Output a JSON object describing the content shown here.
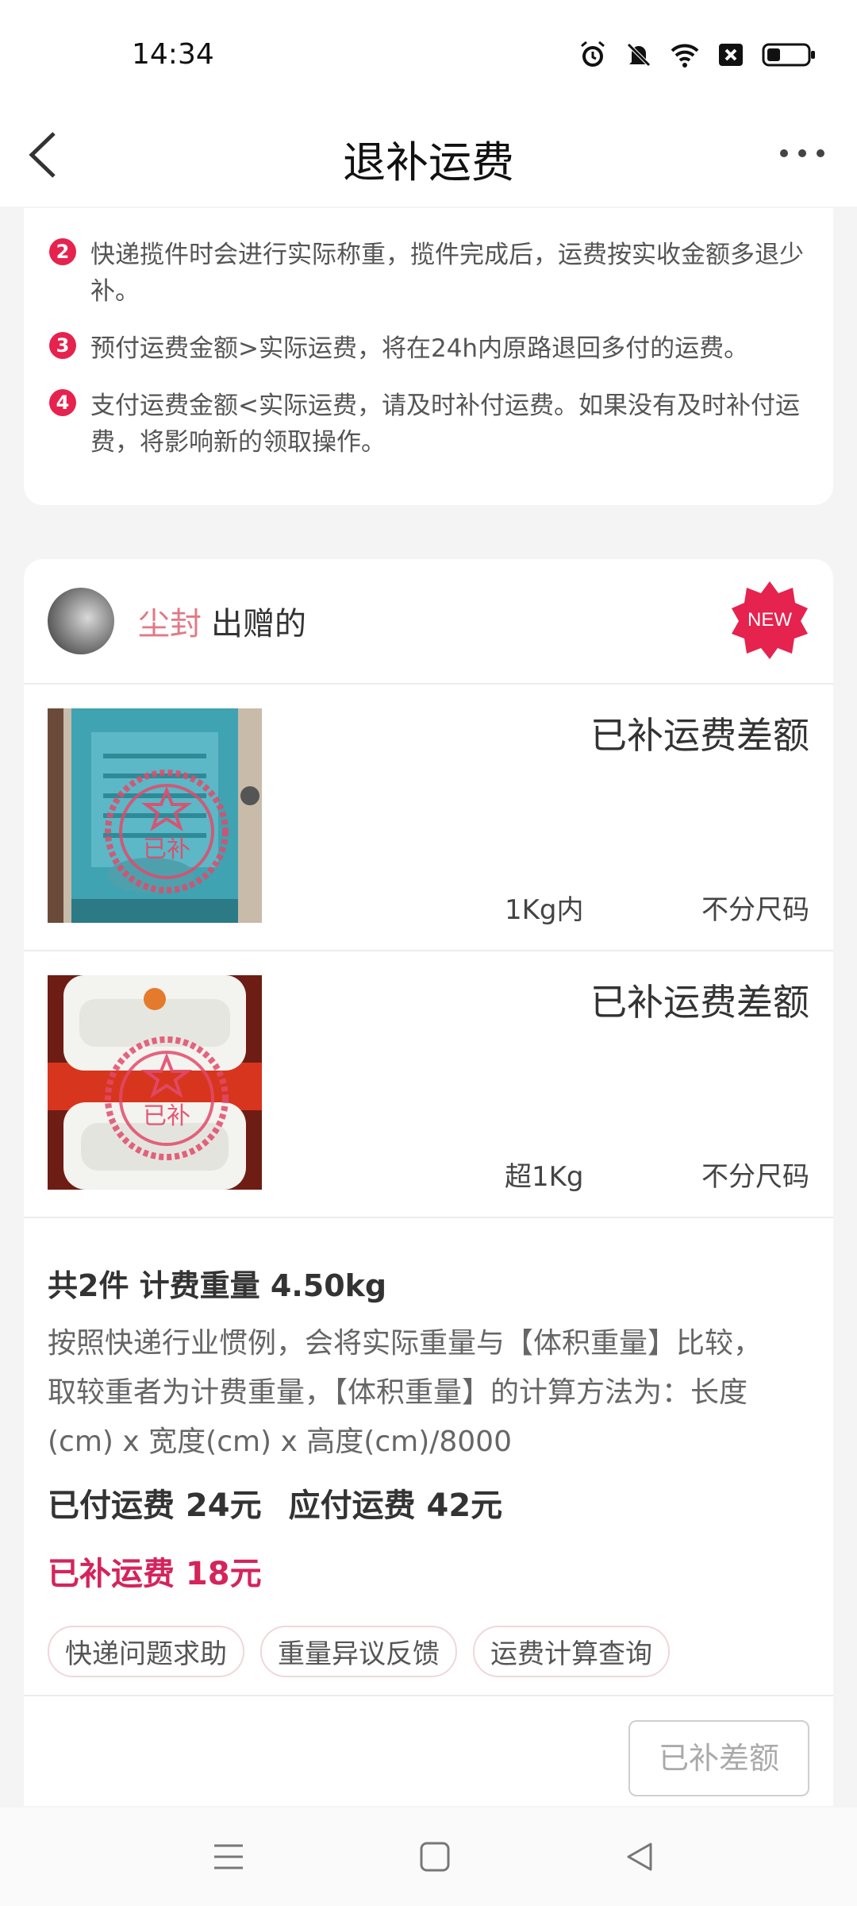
{
  "status_bar": {
    "time": "14:34"
  },
  "nav": {
    "title": "退补运费"
  },
  "rules": [
    {
      "num": "2",
      "text": "快递揽件时会进行实际称重，揽件完成后，运费按实收金额多退少补。"
    },
    {
      "num": "3",
      "text": "预付运费金额>实际运费，将在24h内原路退回多付的运费。"
    },
    {
      "num": "4",
      "text": "支付运费金额<实际运费，请及时补付运费。如果没有及时补付运费，将影响新的领取操作。"
    }
  ],
  "giver": {
    "name": "尘封",
    "suffix": "出赠的",
    "badge": "NEW"
  },
  "items": [
    {
      "status": "已补运费差额",
      "weight": "1Kg内",
      "size": "不分尺码",
      "stamp": "已补"
    },
    {
      "status": "已补运费差额",
      "weight": "超1Kg",
      "size": "不分尺码",
      "stamp": "已补"
    }
  ],
  "summary": {
    "headline": "共2件 计费重量 4.50kg",
    "description": "按照快递行业惯例，会将实际重量与【体积重量】比较，取较重者为计费重量，【体积重量】的计算方法为：长度(cm) x 宽度(cm) x 高度(cm)/8000",
    "paid": "已付运费 24元",
    "due": "应付运费 42元",
    "extra": "已补运费 18元",
    "tags": [
      "快递问题求助",
      "重量异议反馈",
      "运费计算查询"
    ]
  },
  "bottom_button": "已补差额",
  "colors": {
    "accent": "#d4245b",
    "name_pink": "#e07a85",
    "badge_red": "#e6224e"
  }
}
